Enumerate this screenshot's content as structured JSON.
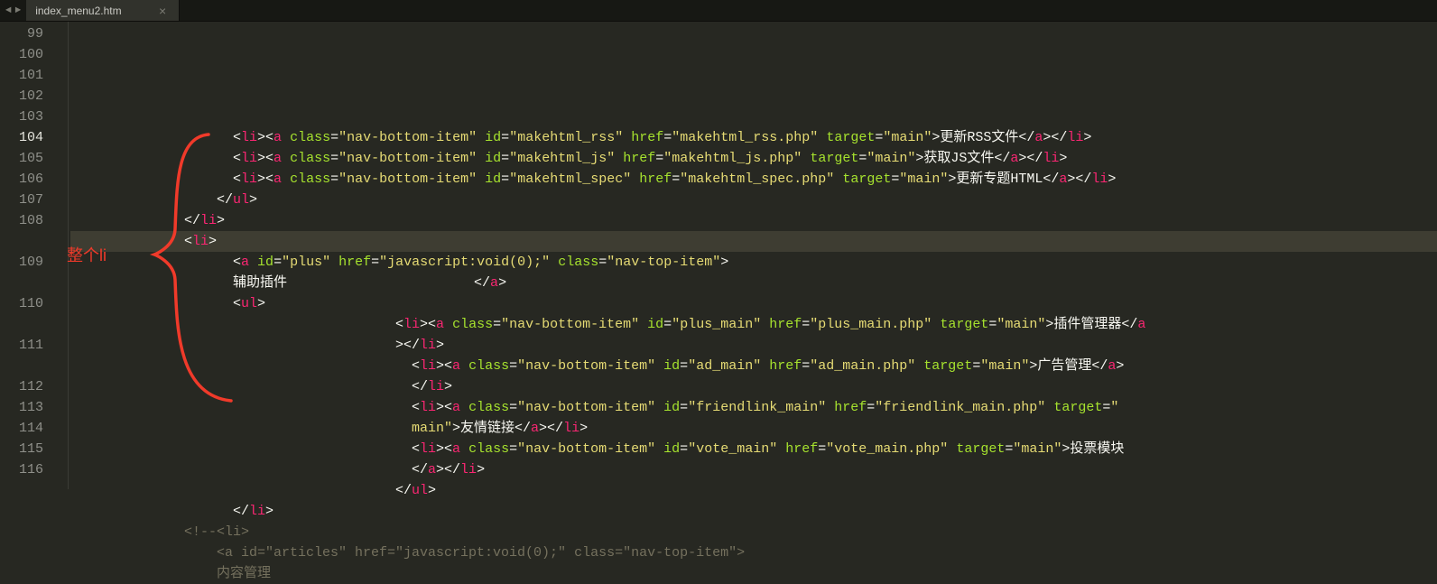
{
  "tab": {
    "title": "index_menu2.htm",
    "close_glyph": "×"
  },
  "nav": {
    "left": "◄",
    "right": "►"
  },
  "annotation": {
    "label": "整个li"
  },
  "gutter_start": 99,
  "cursor_line": 104,
  "rows": [
    {
      "indent": 20,
      "segs": [
        {
          "t": "<",
          "c": "txt"
        },
        {
          "t": "li",
          "c": "tag"
        },
        {
          "t": "><",
          "c": "txt"
        },
        {
          "t": "a",
          "c": "tag"
        },
        {
          "t": " ",
          "c": "txt"
        },
        {
          "t": "class",
          "c": "attr"
        },
        {
          "t": "=",
          "c": "txt"
        },
        {
          "t": "\"nav-bottom-item\"",
          "c": "val"
        },
        {
          "t": " ",
          "c": "txt"
        },
        {
          "t": "id",
          "c": "attr"
        },
        {
          "t": "=",
          "c": "txt"
        },
        {
          "t": "\"makehtml_rss\"",
          "c": "val"
        },
        {
          "t": " ",
          "c": "txt"
        },
        {
          "t": "href",
          "c": "attr"
        },
        {
          "t": "=",
          "c": "txt"
        },
        {
          "t": "\"makehtml_rss.php\"",
          "c": "val"
        },
        {
          "t": " ",
          "c": "txt"
        },
        {
          "t": "target",
          "c": "attr"
        },
        {
          "t": "=",
          "c": "txt"
        },
        {
          "t": "\"main\"",
          "c": "val"
        },
        {
          "t": ">更新RSS文件</",
          "c": "txt"
        },
        {
          "t": "a",
          "c": "tag"
        },
        {
          "t": "></",
          "c": "txt"
        },
        {
          "t": "li",
          "c": "tag"
        },
        {
          "t": ">",
          "c": "txt"
        }
      ]
    },
    {
      "indent": 20,
      "segs": [
        {
          "t": "<",
          "c": "txt"
        },
        {
          "t": "li",
          "c": "tag"
        },
        {
          "t": "><",
          "c": "txt"
        },
        {
          "t": "a",
          "c": "tag"
        },
        {
          "t": " ",
          "c": "txt"
        },
        {
          "t": "class",
          "c": "attr"
        },
        {
          "t": "=",
          "c": "txt"
        },
        {
          "t": "\"nav-bottom-item\"",
          "c": "val"
        },
        {
          "t": " ",
          "c": "txt"
        },
        {
          "t": "id",
          "c": "attr"
        },
        {
          "t": "=",
          "c": "txt"
        },
        {
          "t": "\"makehtml_js\"",
          "c": "val"
        },
        {
          "t": " ",
          "c": "txt"
        },
        {
          "t": "href",
          "c": "attr"
        },
        {
          "t": "=",
          "c": "txt"
        },
        {
          "t": "\"makehtml_js.php\"",
          "c": "val"
        },
        {
          "t": " ",
          "c": "txt"
        },
        {
          "t": "target",
          "c": "attr"
        },
        {
          "t": "=",
          "c": "txt"
        },
        {
          "t": "\"main\"",
          "c": "val"
        },
        {
          "t": ">获取JS文件</",
          "c": "txt"
        },
        {
          "t": "a",
          "c": "tag"
        },
        {
          "t": "></",
          "c": "txt"
        },
        {
          "t": "li",
          "c": "tag"
        },
        {
          "t": ">",
          "c": "txt"
        }
      ]
    },
    {
      "indent": 20,
      "segs": [
        {
          "t": "<",
          "c": "txt"
        },
        {
          "t": "li",
          "c": "tag"
        },
        {
          "t": "><",
          "c": "txt"
        },
        {
          "t": "a",
          "c": "tag"
        },
        {
          "t": " ",
          "c": "txt"
        },
        {
          "t": "class",
          "c": "attr"
        },
        {
          "t": "=",
          "c": "txt"
        },
        {
          "t": "\"nav-bottom-item\"",
          "c": "val"
        },
        {
          "t": " ",
          "c": "txt"
        },
        {
          "t": "id",
          "c": "attr"
        },
        {
          "t": "=",
          "c": "txt"
        },
        {
          "t": "\"makehtml_spec\"",
          "c": "val"
        },
        {
          "t": " ",
          "c": "txt"
        },
        {
          "t": "href",
          "c": "attr"
        },
        {
          "t": "=",
          "c": "txt"
        },
        {
          "t": "\"makehtml_spec.php\"",
          "c": "val"
        },
        {
          "t": " ",
          "c": "txt"
        },
        {
          "t": "target",
          "c": "attr"
        },
        {
          "t": "=",
          "c": "txt"
        },
        {
          "t": "\"main\"",
          "c": "val"
        },
        {
          "t": ">更新专题HTML</",
          "c": "txt"
        },
        {
          "t": "a",
          "c": "tag"
        },
        {
          "t": "></",
          "c": "txt"
        },
        {
          "t": "li",
          "c": "tag"
        },
        {
          "t": ">",
          "c": "txt"
        }
      ]
    },
    {
      "indent": 18,
      "segs": [
        {
          "t": "</",
          "c": "txt"
        },
        {
          "t": "ul",
          "c": "tag"
        },
        {
          "t": ">",
          "c": "txt"
        }
      ]
    },
    {
      "indent": 14,
      "segs": [
        {
          "t": "</",
          "c": "txt"
        },
        {
          "t": "li",
          "c": "tag"
        },
        {
          "t": ">",
          "c": "txt"
        }
      ]
    },
    {
      "indent": 14,
      "segs": [
        {
          "t": "<",
          "c": "txt"
        },
        {
          "t": "li",
          "c": "tag"
        },
        {
          "t": ">",
          "c": "txt"
        }
      ]
    },
    {
      "indent": 20,
      "segs": [
        {
          "t": "<",
          "c": "txt"
        },
        {
          "t": "a",
          "c": "tag"
        },
        {
          "t": " ",
          "c": "txt"
        },
        {
          "t": "id",
          "c": "attr"
        },
        {
          "t": "=",
          "c": "txt"
        },
        {
          "t": "\"plus\"",
          "c": "val"
        },
        {
          "t": " ",
          "c": "txt"
        },
        {
          "t": "href",
          "c": "attr"
        },
        {
          "t": "=",
          "c": "txt"
        },
        {
          "t": "\"javascript:void(0);\"",
          "c": "val"
        },
        {
          "t": " ",
          "c": "txt"
        },
        {
          "t": "class",
          "c": "attr"
        },
        {
          "t": "=",
          "c": "txt"
        },
        {
          "t": "\"nav-top-item\"",
          "c": "val"
        },
        {
          "t": ">",
          "c": "txt"
        }
      ]
    },
    {
      "indent": 20,
      "segs": [
        {
          "t": "辅助插件                       </",
          "c": "txt"
        },
        {
          "t": "a",
          "c": "tag"
        },
        {
          "t": ">",
          "c": "txt"
        }
      ]
    },
    {
      "indent": 20,
      "segs": [
        {
          "t": "<",
          "c": "txt"
        },
        {
          "t": "ul",
          "c": "tag"
        },
        {
          "t": ">",
          "c": "txt"
        }
      ]
    },
    {
      "indent": 40,
      "segs": [
        {
          "t": "<",
          "c": "txt"
        },
        {
          "t": "li",
          "c": "tag"
        },
        {
          "t": "><",
          "c": "txt"
        },
        {
          "t": "a",
          "c": "tag"
        },
        {
          "t": " ",
          "c": "txt"
        },
        {
          "t": "class",
          "c": "attr"
        },
        {
          "t": "=",
          "c": "txt"
        },
        {
          "t": "\"nav-bottom-item\"",
          "c": "val"
        },
        {
          "t": " ",
          "c": "txt"
        },
        {
          "t": "id",
          "c": "attr"
        },
        {
          "t": "=",
          "c": "txt"
        },
        {
          "t": "\"plus_main\"",
          "c": "val"
        },
        {
          "t": " ",
          "c": "txt"
        },
        {
          "t": "href",
          "c": "attr"
        },
        {
          "t": "=",
          "c": "txt"
        },
        {
          "t": "\"plus_main.php\"",
          "c": "val"
        },
        {
          "t": " ",
          "c": "txt"
        },
        {
          "t": "target",
          "c": "attr"
        },
        {
          "t": "=",
          "c": "txt"
        },
        {
          "t": "\"main\"",
          "c": "val"
        },
        {
          "t": ">插件管理器</",
          "c": "txt"
        },
        {
          "t": "a",
          "c": "tag"
        }
      ]
    },
    {
      "indent": 40,
      "segs": [
        {
          "t": "></",
          "c": "txt"
        },
        {
          "t": "li",
          "c": "tag"
        },
        {
          "t": ">",
          "c": "txt"
        }
      ],
      "wrapped": true
    },
    {
      "indent": 42,
      "segs": [
        {
          "t": "<",
          "c": "txt"
        },
        {
          "t": "li",
          "c": "tag"
        },
        {
          "t": "><",
          "c": "txt"
        },
        {
          "t": "a",
          "c": "tag"
        },
        {
          "t": " ",
          "c": "txt"
        },
        {
          "t": "class",
          "c": "attr"
        },
        {
          "t": "=",
          "c": "txt"
        },
        {
          "t": "\"nav-bottom-item\"",
          "c": "val"
        },
        {
          "t": " ",
          "c": "txt"
        },
        {
          "t": "id",
          "c": "attr"
        },
        {
          "t": "=",
          "c": "txt"
        },
        {
          "t": "\"ad_main\"",
          "c": "val"
        },
        {
          "t": " ",
          "c": "txt"
        },
        {
          "t": "href",
          "c": "attr"
        },
        {
          "t": "=",
          "c": "txt"
        },
        {
          "t": "\"ad_main.php\"",
          "c": "val"
        },
        {
          "t": " ",
          "c": "txt"
        },
        {
          "t": "target",
          "c": "attr"
        },
        {
          "t": "=",
          "c": "txt"
        },
        {
          "t": "\"main\"",
          "c": "val"
        },
        {
          "t": ">广告管理</",
          "c": "txt"
        },
        {
          "t": "a",
          "c": "tag"
        },
        {
          "t": ">",
          "c": "txt"
        }
      ]
    },
    {
      "indent": 42,
      "segs": [
        {
          "t": "</",
          "c": "txt"
        },
        {
          "t": "li",
          "c": "tag"
        },
        {
          "t": ">",
          "c": "txt"
        }
      ],
      "wrapped": true
    },
    {
      "indent": 42,
      "segs": [
        {
          "t": "<",
          "c": "txt"
        },
        {
          "t": "li",
          "c": "tag"
        },
        {
          "t": "><",
          "c": "txt"
        },
        {
          "t": "a",
          "c": "tag"
        },
        {
          "t": " ",
          "c": "txt"
        },
        {
          "t": "class",
          "c": "attr"
        },
        {
          "t": "=",
          "c": "txt"
        },
        {
          "t": "\"nav-bottom-item\"",
          "c": "val"
        },
        {
          "t": " ",
          "c": "txt"
        },
        {
          "t": "id",
          "c": "attr"
        },
        {
          "t": "=",
          "c": "txt"
        },
        {
          "t": "\"friendlink_main\"",
          "c": "val"
        },
        {
          "t": " ",
          "c": "txt"
        },
        {
          "t": "href",
          "c": "attr"
        },
        {
          "t": "=",
          "c": "txt"
        },
        {
          "t": "\"friendlink_main.php\"",
          "c": "val"
        },
        {
          "t": " ",
          "c": "txt"
        },
        {
          "t": "target",
          "c": "attr"
        },
        {
          "t": "=",
          "c": "txt"
        },
        {
          "t": "\"",
          "c": "val"
        }
      ]
    },
    {
      "indent": 42,
      "segs": [
        {
          "t": "main\"",
          "c": "val"
        },
        {
          "t": ">友情链接</",
          "c": "txt"
        },
        {
          "t": "a",
          "c": "tag"
        },
        {
          "t": "></",
          "c": "txt"
        },
        {
          "t": "li",
          "c": "tag"
        },
        {
          "t": ">",
          "c": "txt"
        }
      ],
      "wrapped": true
    },
    {
      "indent": 42,
      "segs": [
        {
          "t": "<",
          "c": "txt"
        },
        {
          "t": "li",
          "c": "tag"
        },
        {
          "t": "><",
          "c": "txt"
        },
        {
          "t": "a",
          "c": "tag"
        },
        {
          "t": " ",
          "c": "txt"
        },
        {
          "t": "class",
          "c": "attr"
        },
        {
          "t": "=",
          "c": "txt"
        },
        {
          "t": "\"nav-bottom-item\"",
          "c": "val"
        },
        {
          "t": " ",
          "c": "txt"
        },
        {
          "t": "id",
          "c": "attr"
        },
        {
          "t": "=",
          "c": "txt"
        },
        {
          "t": "\"vote_main\"",
          "c": "val"
        },
        {
          "t": " ",
          "c": "txt"
        },
        {
          "t": "href",
          "c": "attr"
        },
        {
          "t": "=",
          "c": "txt"
        },
        {
          "t": "\"vote_main.php\"",
          "c": "val"
        },
        {
          "t": " ",
          "c": "txt"
        },
        {
          "t": "target",
          "c": "attr"
        },
        {
          "t": "=",
          "c": "txt"
        },
        {
          "t": "\"main\"",
          "c": "val"
        },
        {
          "t": ">投票模块",
          "c": "txt"
        }
      ]
    },
    {
      "indent": 42,
      "segs": [
        {
          "t": "</",
          "c": "txt"
        },
        {
          "t": "a",
          "c": "tag"
        },
        {
          "t": "></",
          "c": "txt"
        },
        {
          "t": "li",
          "c": "tag"
        },
        {
          "t": ">",
          "c": "txt"
        }
      ],
      "wrapped": true
    },
    {
      "indent": 40,
      "segs": [
        {
          "t": "</",
          "c": "txt"
        },
        {
          "t": "ul",
          "c": "tag"
        },
        {
          "t": ">",
          "c": "txt"
        }
      ]
    },
    {
      "indent": 20,
      "segs": [
        {
          "t": "</",
          "c": "txt"
        },
        {
          "t": "li",
          "c": "tag"
        },
        {
          "t": ">",
          "c": "txt"
        }
      ]
    },
    {
      "indent": 14,
      "segs": [
        {
          "t": "<!--<li>",
          "c": "cmt"
        }
      ]
    },
    {
      "indent": 18,
      "segs": [
        {
          "t": "<a id=\"articles\" href=\"javascript:void(0);\" class=\"nav-top-item\">",
          "c": "cmt"
        }
      ]
    },
    {
      "indent": 18,
      "segs": [
        {
          "t": "内容管理",
          "c": "cmt"
        }
      ]
    }
  ]
}
